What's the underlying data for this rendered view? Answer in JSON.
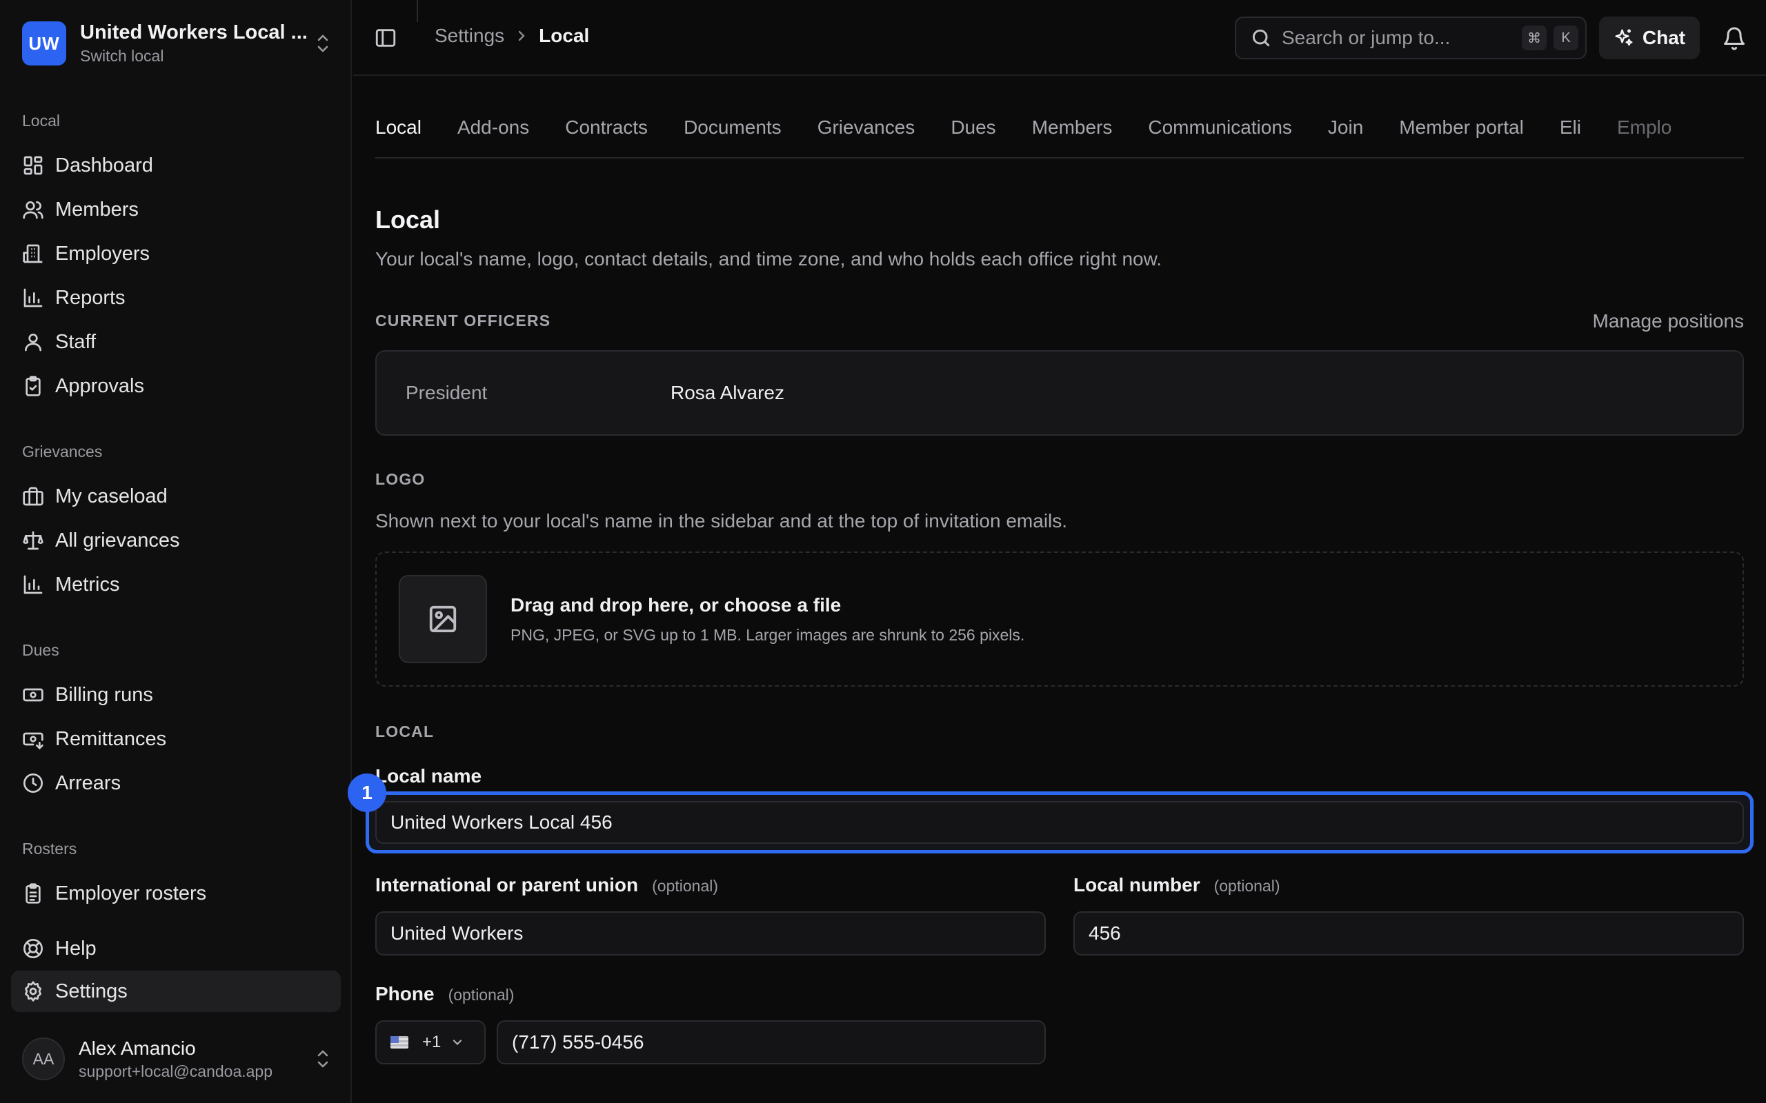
{
  "org": {
    "initials": "UW",
    "name": "United Workers Local ...",
    "subtitle": "Switch local"
  },
  "nav_sections": {
    "local": {
      "title": "Local",
      "items": [
        "Dashboard",
        "Members",
        "Employers",
        "Reports",
        "Staff",
        "Approvals"
      ]
    },
    "grievances": {
      "title": "Grievances",
      "items": [
        "My caseload",
        "All grievances",
        "Metrics"
      ]
    },
    "dues": {
      "title": "Dues",
      "items": [
        "Billing runs",
        "Remittances",
        "Arrears"
      ]
    },
    "rosters": {
      "title": "Rosters",
      "items": [
        "Employer rosters"
      ]
    }
  },
  "nav_bottom": {
    "help": "Help",
    "settings": "Settings"
  },
  "user": {
    "initials": "AA",
    "name": "Alex Amancio",
    "email": "support+local@candoa.app"
  },
  "breadcrumb": {
    "parent": "Settings",
    "current": "Local"
  },
  "search": {
    "placeholder": "Search or jump to...",
    "kbd_cmd": "⌘",
    "kbd_key": "K"
  },
  "chat": {
    "label": "Chat"
  },
  "tabs": [
    "Local",
    "Add-ons",
    "Contracts",
    "Documents",
    "Grievances",
    "Dues",
    "Members",
    "Communications",
    "Join",
    "Member portal",
    "Eli",
    "Emplo"
  ],
  "page": {
    "title": "Local",
    "description": "Your local's name, logo, contact details, and time zone, and who holds each office right now."
  },
  "officers": {
    "section": "CURRENT OFFICERS",
    "manage": "Manage positions",
    "role": "President",
    "name": "Rosa Alvarez"
  },
  "logo": {
    "section": "LOGO",
    "description": "Shown next to your local's name in the sidebar and at the top of invitation emails.",
    "drop_title": "Drag and drop here, or choose a file",
    "drop_sub": "PNG, JPEG, or SVG up to 1 MB. Larger images are shrunk to 256 pixels."
  },
  "local_form": {
    "section": "LOCAL",
    "local_name_label": "Local name",
    "local_name_value": "United Workers Local 456",
    "parent_label": "International or parent union",
    "parent_value": "United Workers",
    "number_label": "Local number",
    "number_value": "456",
    "optional": "(optional)",
    "phone_label": "Phone",
    "phone_code": "+1",
    "phone_value": "(717) 555-0456"
  },
  "annotation": {
    "badge": "1"
  },
  "colors": {
    "accent": "#2c63f0",
    "focus": "#2f6bf2",
    "background": "#0b0b0c"
  }
}
